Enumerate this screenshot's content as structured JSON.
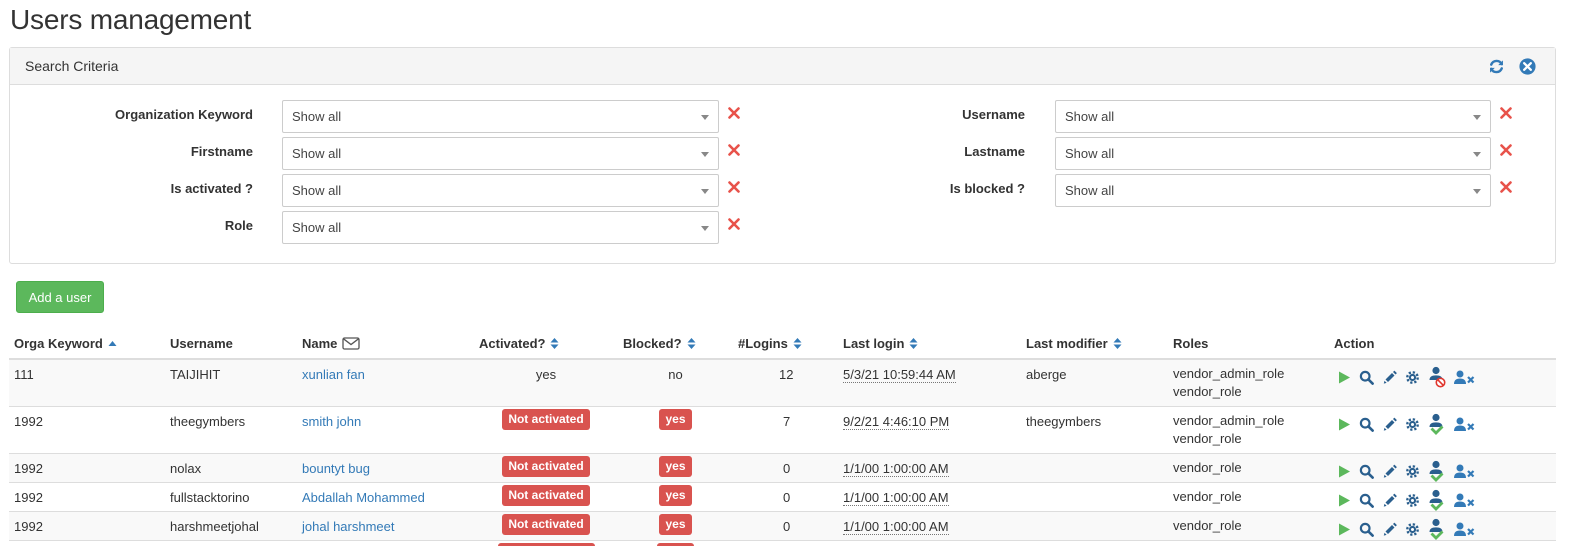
{
  "page": {
    "title": "Users management"
  },
  "search": {
    "title": "Search Criteria",
    "fields": {
      "organization_keyword": {
        "label": "Organization Keyword",
        "value": "Show all"
      },
      "firstname": {
        "label": "Firstname",
        "value": "Show all"
      },
      "is_activated": {
        "label": "Is activated ?",
        "value": "Show all"
      },
      "role": {
        "label": "Role",
        "value": "Show all"
      },
      "username": {
        "label": "Username",
        "value": "Show all"
      },
      "lastname": {
        "label": "Lastname",
        "value": "Show all"
      },
      "is_blocked": {
        "label": "Is blocked ?",
        "value": "Show all"
      }
    }
  },
  "toolbar": {
    "add_user_label": "Add a user"
  },
  "table": {
    "columns": {
      "orga_keyword": "Orga Keyword",
      "username": "Username",
      "name": "Name",
      "activated": "Activated?",
      "blocked": "Blocked?",
      "logins": "#Logins",
      "last_login": "Last login",
      "last_modifier": "Last modifier",
      "roles": "Roles",
      "action": "Action"
    },
    "rows": [
      {
        "orga_keyword": "111",
        "username": "TAIJIHIT",
        "name": "xunlian fan",
        "activated": "yes",
        "blocked": "no",
        "logins": "12",
        "last_login": "5/3/21 10:59:44 AM",
        "last_modifier": "aberge",
        "roles": [
          "vendor_admin_role",
          "vendor_role"
        ]
      },
      {
        "orga_keyword": "1992",
        "username": "theegymbers",
        "name": "smith john",
        "activated": "Not activated",
        "blocked": "yes",
        "logins": "7",
        "last_login": "9/2/21 4:46:10 PM",
        "last_modifier": "theegymbers",
        "roles": [
          "vendor_admin_role",
          "vendor_role"
        ]
      },
      {
        "orga_keyword": "1992",
        "username": "nolax",
        "name": "bountyt bug",
        "activated": "Not activated",
        "blocked": "yes",
        "logins": "0",
        "last_login": "1/1/00 1:00:00 AM",
        "last_modifier": "",
        "roles": [
          "vendor_role"
        ]
      },
      {
        "orga_keyword": "1992",
        "username": "fullstacktorino",
        "name": "Abdallah Mohammed",
        "activated": "Not activated",
        "blocked": "yes",
        "logins": "0",
        "last_login": "1/1/00 1:00:00 AM",
        "last_modifier": "",
        "roles": [
          "vendor_role"
        ]
      },
      {
        "orga_keyword": "1992",
        "username": "harshmeetjohal",
        "name": "johal harshmeet",
        "activated": "Not activated",
        "blocked": "yes",
        "logins": "0",
        "last_login": "1/1/00 1:00:00 AM",
        "last_modifier": "",
        "roles": [
          "vendor_role"
        ]
      }
    ]
  },
  "colors": {
    "primary": "#337ab7",
    "success": "#5cb85c",
    "danger": "#d9534f",
    "clear_x": "#e8524a",
    "gear": "#2a5f8e"
  },
  "icons": {
    "row_actions": [
      "play-icon",
      "search-icon",
      "pencil-icon",
      "gear-icon",
      "user-status-icon",
      "user-remove-icon"
    ],
    "row_status_icons": [
      "user-blocked-icon",
      "user-check-icon",
      "user-check-icon",
      "user-check-icon",
      "user-check-icon"
    ]
  }
}
